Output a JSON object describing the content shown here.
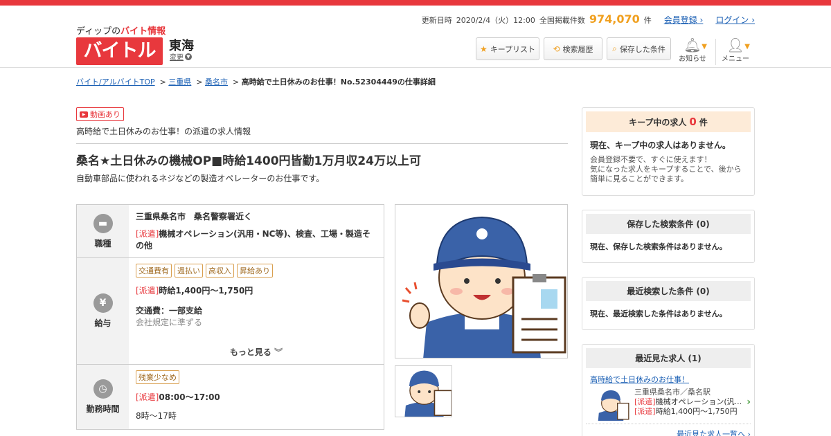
{
  "header": {
    "logo_sub_a": "ディップの",
    "logo_sub_b": "バイト情報",
    "logo_main": "バイトル",
    "region": "東海",
    "region_change": "変更",
    "update_label": "更新日時",
    "update_time": "2020/2/4（火）12:00",
    "listing_label": "全国掲載件数",
    "listing_count": "974,070",
    "listing_unit": "件",
    "register": "会員登録",
    "login": "ログイン",
    "buttons": [
      "キープリスト",
      "検索履歴",
      "保存した条件"
    ],
    "notify": "お知らせ",
    "menu": "メニュー"
  },
  "breadcrumb": {
    "top": "バイト/アルバイトTOP",
    "pref": "三重県",
    "city": "桑名市",
    "current": "高時給で土日休みのお仕事！No.52304449の仕事詳細"
  },
  "job": {
    "video_badge": "動画あり",
    "subtitle": "高時給で土日休みのお仕事！の派遣の求人情報",
    "title": "桑名★土日休みの機械OP■時給1400円皆勤1万月収24万以上可",
    "desc": "自動車部品に使われるネジなどの製造オペレーターのお仕事です。",
    "rows": {
      "shokushu": {
        "label": "職種",
        "location": "三重県桑名市　桑名警察署近く",
        "dispatch": "[派遣]",
        "text": "機械オペレーション(汎用・NC等)、検査、工場・製造その他"
      },
      "kyuyo": {
        "label": "給与",
        "tags": [
          "交通費有",
          "週払い",
          "高収入",
          "昇給あり"
        ],
        "dispatch": "[派遣]",
        "wage": "時給1,400円～1,750円",
        "transport": "交通費：一部支給",
        "transport_note": "会社規定に準ずる",
        "more": "もっと見る"
      },
      "kinmu": {
        "label": "勤務時間",
        "tags": [
          "残業少なめ"
        ],
        "dispatch": "[派遣]",
        "time": "08:00～17:00",
        "note": "8時～17時"
      }
    }
  },
  "side": {
    "keep_head_a": "キープ中の求人",
    "keep_count": "0",
    "keep_unit": "件",
    "keep_empty": "現在、キープ中の求人はありません。",
    "keep_note": "会員登録不要で、すぐに使えます！\n気になった求人をキープすることで、後から簡単に見ることができます。",
    "saved_head": "保存した検索条件 (0)",
    "saved_empty": "現在、保存した検索条件はありません。",
    "recent_search_head": "最近検索した条件 (0)",
    "recent_search_empty": "現在、最近検索した条件はありません。",
    "recent_view_head": "最近見た求人 (1)",
    "recent_link": "高時給で土日休みのお仕事！",
    "recent_loc": "三重県桑名市／桑名駅",
    "recent_dispatch": "[派遣]",
    "recent_job": "機械オペレーション(汎...",
    "recent_wage": "時給1,400円～1,750円",
    "recent_all": "最近見た求人一覧へ"
  },
  "colors": {
    "brand": "#e8383d",
    "accent": "#f0a020",
    "link": "#1a5fb4"
  }
}
